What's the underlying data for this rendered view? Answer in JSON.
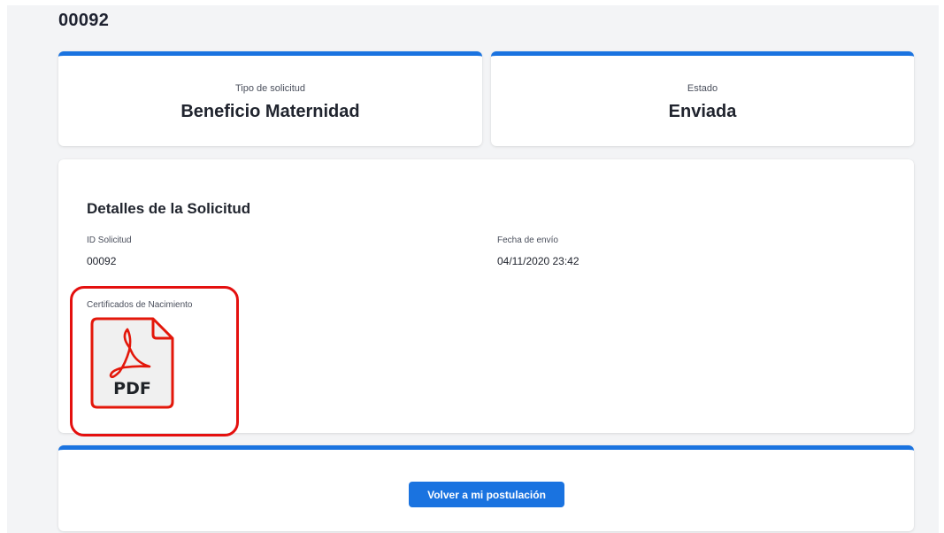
{
  "header": {
    "title": "00092"
  },
  "summary": {
    "request_type_label": "Tipo de solicitud",
    "request_type_value": "Beneficio Maternidad",
    "status_label": "Estado",
    "status_value": "Enviada"
  },
  "details": {
    "title": "Detalles de la Solicitud",
    "id_label": "ID Solicitud",
    "id_value": "00092",
    "date_label": "Fecha de envío",
    "date_value": "04/11/2020 23:42",
    "certificates_label": "Certificados de Nacimiento",
    "attachment": {
      "icon": "pdf-file-icon",
      "label": "PDF"
    }
  },
  "footer": {
    "back_button_label": "Volver a mi postulación"
  },
  "colors": {
    "accent": "#1a73e0",
    "highlight": "#e4100f",
    "pdf_red": "#e3170a"
  }
}
